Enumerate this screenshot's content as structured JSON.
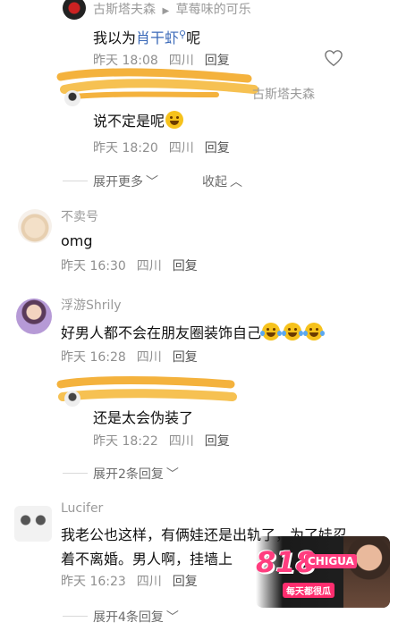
{
  "colors": {
    "link": "#3a69b8",
    "meta": "#8f8f8f",
    "name": "#9a9a9a",
    "scribble": "#f4b23d",
    "ad_pink": "#ff3d7f"
  },
  "comments": [
    {
      "name": "古斯塔夫森",
      "reply_to": "草莓味的可乐",
      "text_prefix": "我以为",
      "text_link": "肖干虾",
      "text_suffix": "呢",
      "time": "昨天 18:08",
      "location": "四川",
      "reply": "回复"
    },
    {
      "name": "古斯塔夫森",
      "text": "说不定是呢",
      "time": "昨天 18:20",
      "location": "四川",
      "reply": "回复"
    },
    {
      "name": "不卖号",
      "text": "omg",
      "time": "昨天 16:30",
      "location": "四川",
      "reply": "回复"
    },
    {
      "name": "浮游Shrily",
      "text": "好男人都不会在朋友圈装饰自己",
      "time": "昨天 16:28",
      "location": "四川",
      "reply": "回复"
    },
    {
      "text": "还是太会伪装了",
      "time": "昨天 18:22",
      "location": "四川",
      "reply": "回复"
    },
    {
      "name": "Lucifer",
      "text_line1": "我老公也这样，有俩娃还是出轨了，为了娃忍",
      "text_line2": "着不离婚。男人啊，挂墙上",
      "time": "昨天 16:23",
      "location": "四川",
      "reply": "回复"
    }
  ],
  "expand_more": "展开更多",
  "collapse": "收起",
  "expand_2": "展开2条回复",
  "expand_4": "展开4条回复",
  "ad": {
    "brand": "818",
    "brand_sub": "CHIGUA",
    "slogan": "每天都很瓜"
  },
  "icons": [
    "heart-icon",
    "search-icon",
    "chevron-down-icon",
    "chevron-up-icon",
    "play-arrow-icon"
  ]
}
